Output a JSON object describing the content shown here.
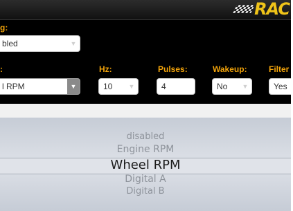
{
  "logo": {
    "text": "RAC",
    "name": "brand-logo"
  },
  "row1": {
    "label": "g:",
    "select_value": "bled"
  },
  "row2": {
    "channel_label": ":",
    "channel_value": "l RPM",
    "hz_label": "Hz:",
    "hz_value": "10",
    "pulses_label": "Pulses:",
    "pulses_value": "4",
    "wakeup_label": "Wakeup:",
    "wakeup_value": "No",
    "filter_label": "Filter",
    "filter_value": "Yes"
  },
  "picker": {
    "options": [
      "disabled",
      "Engine RPM",
      "Wheel RPM",
      "Digital A",
      "Digital B"
    ],
    "selected": "Wheel RPM"
  },
  "colors": {
    "label_accent": "#f0a20a",
    "logo_yellow": "#f0c419",
    "panel_bg": "#000000",
    "picker_bg": "#d9dde4"
  },
  "icons": {
    "dropdown": "chevron-down-icon"
  }
}
